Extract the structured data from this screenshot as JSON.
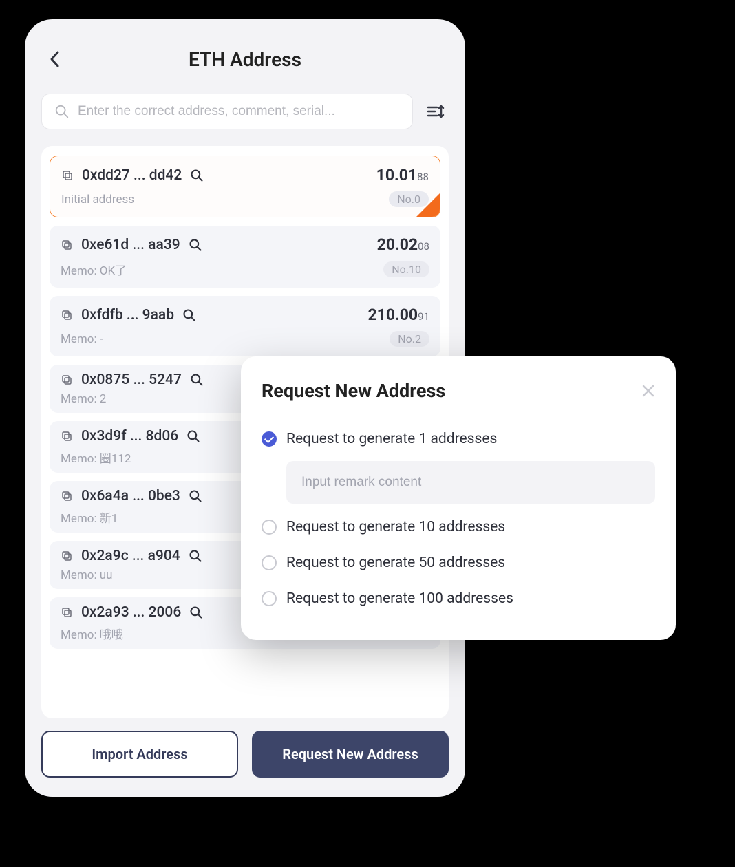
{
  "header": {
    "title": "ETH Address"
  },
  "search": {
    "placeholder": "Enter the correct address, comment, serial..."
  },
  "addresses": [
    {
      "addr": "0xdd27 ... dd42",
      "balance_main": "10.01",
      "balance_sub": "88",
      "memo": "Initial address",
      "no": "No.0",
      "selected": true
    },
    {
      "addr": "0xe61d ... aa39",
      "balance_main": "20.02",
      "balance_sub": "08",
      "memo": "Memo: OK了",
      "no": "No.10",
      "selected": false
    },
    {
      "addr": "0xfdfb ... 9aab",
      "balance_main": "210.00",
      "balance_sub": "91",
      "memo": "Memo: -",
      "no": "No.2",
      "selected": false
    },
    {
      "addr": "0x0875 ... 5247",
      "balance_main": "",
      "balance_sub": "",
      "memo": "Memo: 2",
      "no": "",
      "selected": false
    },
    {
      "addr": "0x3d9f ... 8d06",
      "balance_main": "",
      "balance_sub": "",
      "memo": "Memo: 圈112",
      "no": "",
      "selected": false
    },
    {
      "addr": "0x6a4a ... 0be3",
      "balance_main": "",
      "balance_sub": "",
      "memo": "Memo: 新1",
      "no": "",
      "selected": false
    },
    {
      "addr": "0x2a9c ... a904",
      "balance_main": "",
      "balance_sub": "",
      "memo": "Memo: uu",
      "no": "",
      "selected": false
    },
    {
      "addr": "0x2a93 ... 2006",
      "balance_main": "",
      "balance_sub": "",
      "memo": "Memo: 哦哦",
      "no": "",
      "selected": false
    }
  ],
  "buttons": {
    "import": "Import Address",
    "request": "Request New Address"
  },
  "modal": {
    "title": "Request New Address",
    "options": [
      "Request to generate 1 addresses",
      "Request to generate 10 addresses",
      "Request to generate 50 addresses",
      "Request to generate 100 addresses"
    ],
    "remark_placeholder": "Input remark content",
    "selected_index": 0
  }
}
